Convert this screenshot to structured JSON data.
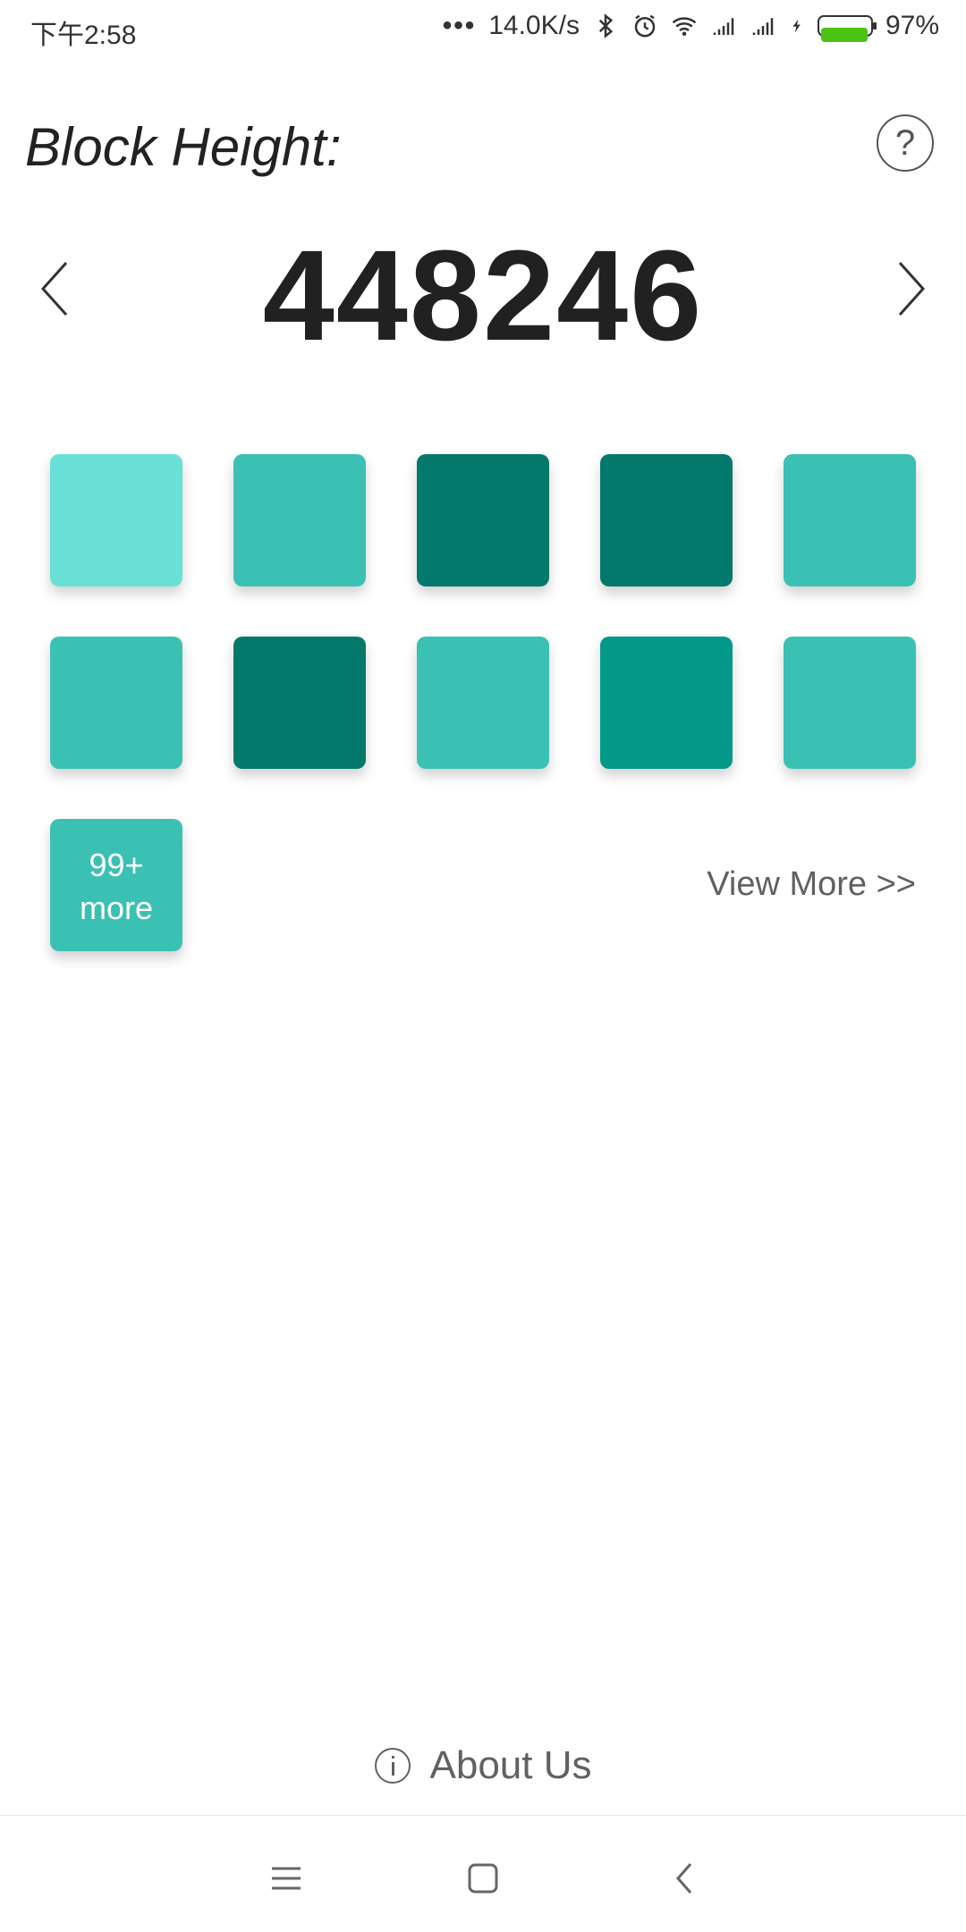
{
  "status_bar": {
    "time": "下午2:58",
    "network_speed": "14.0K/s",
    "battery_percent": "97%",
    "battery_level": 0.97,
    "icons": [
      "more-dots-icon",
      "bluetooth-icon",
      "alarm-icon",
      "wifi-icon",
      "signal-icon",
      "signal-icon",
      "charging-icon",
      "battery-icon"
    ]
  },
  "header": {
    "title": "Block Height:",
    "help_label": "?"
  },
  "block": {
    "height": "448246"
  },
  "tiles": {
    "colors": [
      "#69e0d5",
      "#3bc1b3",
      "#03796b",
      "#03796b",
      "#3bc1b3",
      "#3bc1b3",
      "#03796b",
      "#3bc1b3",
      "#039988",
      "#3bc1b3"
    ],
    "more_color": "#3bc1b3",
    "more_line1": "99+",
    "more_line2": "more"
  },
  "view_more": "View More >>",
  "footer": {
    "about_label": "About Us"
  },
  "navbar": {
    "icons": [
      "menu-icon",
      "home-icon",
      "back-icon"
    ]
  }
}
